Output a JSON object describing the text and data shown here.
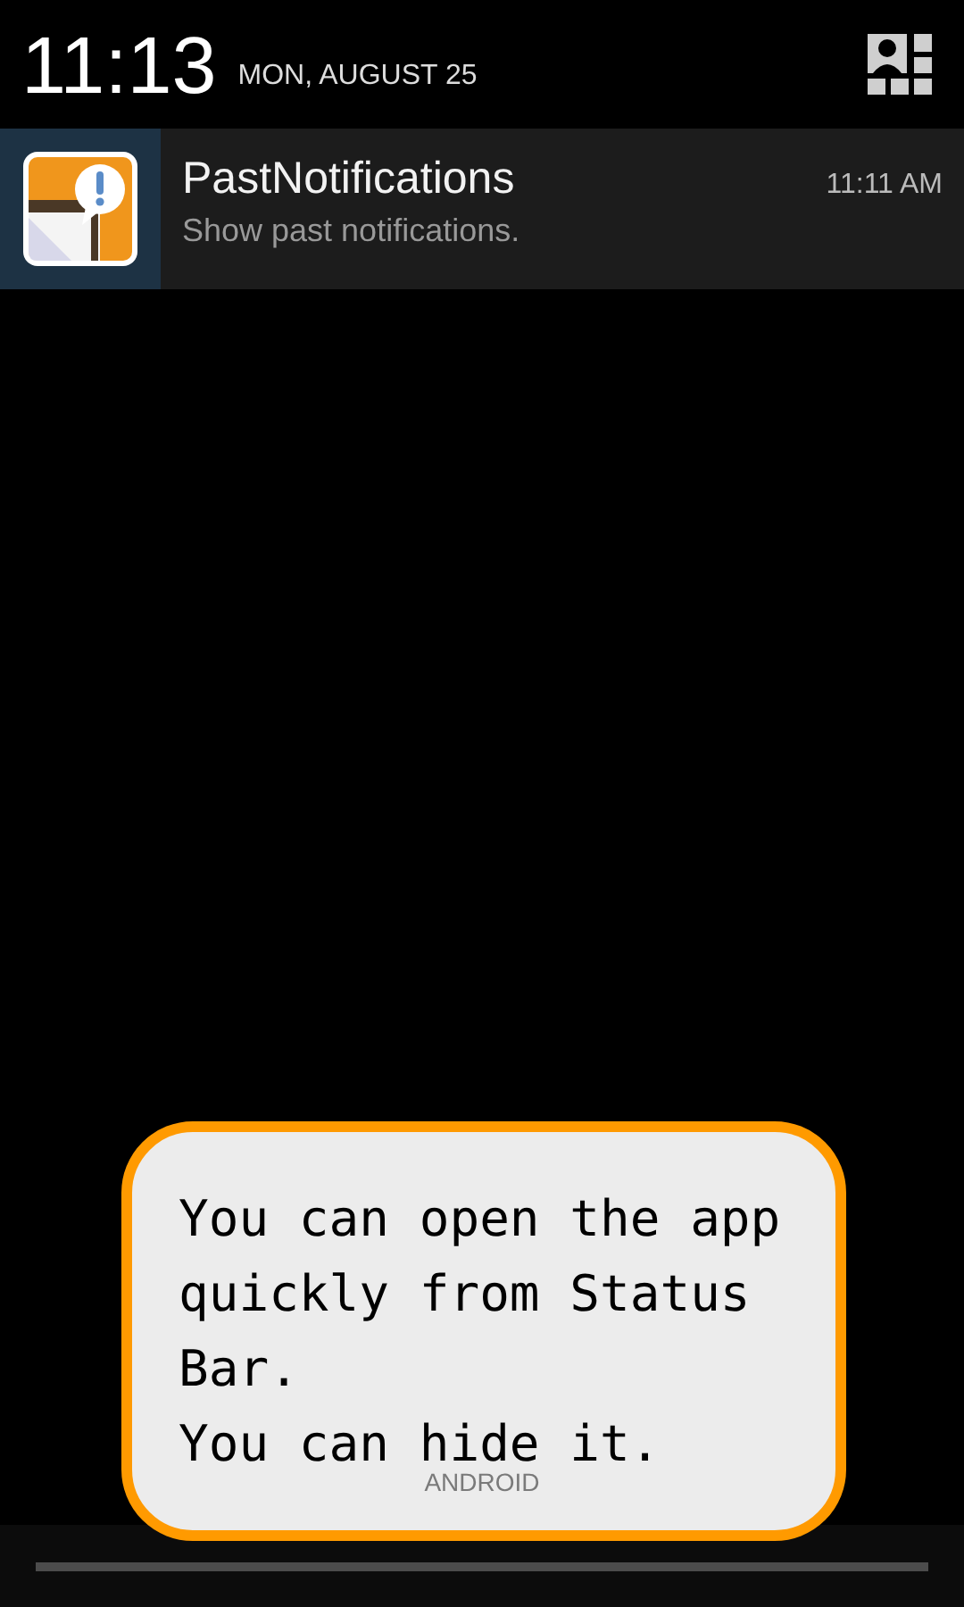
{
  "header": {
    "time": "11:13",
    "date": "MON, AUGUST 25"
  },
  "notifications": [
    {
      "title": "PastNotifications",
      "text": "Show past notifications.",
      "time": "11:11 AM"
    }
  ],
  "carrier_label": "ANDROID",
  "tip": {
    "lines": [
      "You can open the app",
      "quickly from Status",
      "Bar.",
      "You can hide it."
    ]
  }
}
